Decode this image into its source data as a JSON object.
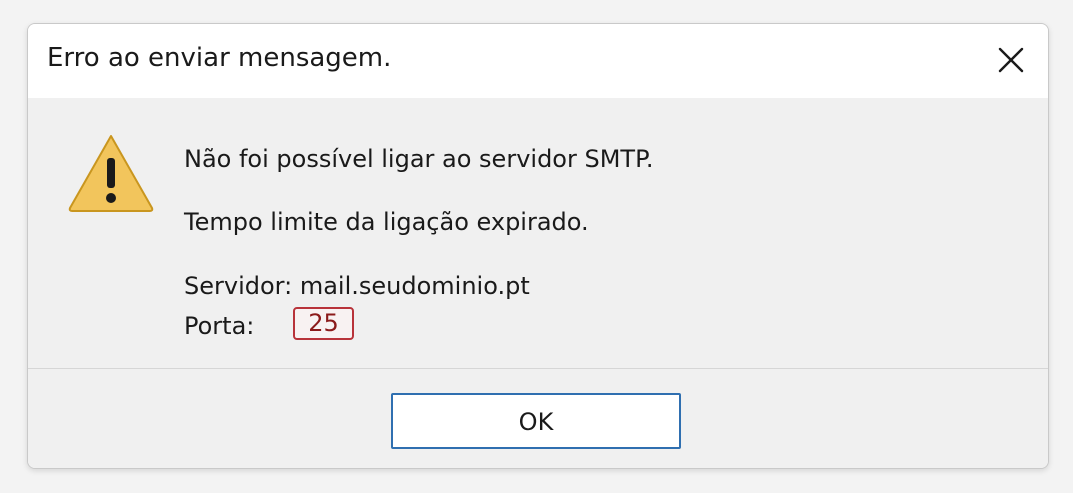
{
  "dialog": {
    "title": "Erro ao enviar mensagem.",
    "close_icon": "close-icon",
    "warning_icon": "warning-icon",
    "messages": {
      "line1": "Não foi possível ligar ao servidor SMTP.",
      "line2": "Tempo limite da ligação expirado.",
      "server": "Servidor: mail.seudominio.pt",
      "port_label": "Porta:",
      "port_value": "25"
    },
    "ok_label": "OK",
    "colors": {
      "port_highlight": "#b8333a",
      "button_border": "#2f6fb0",
      "warning_fill": "#f2c55c"
    }
  }
}
